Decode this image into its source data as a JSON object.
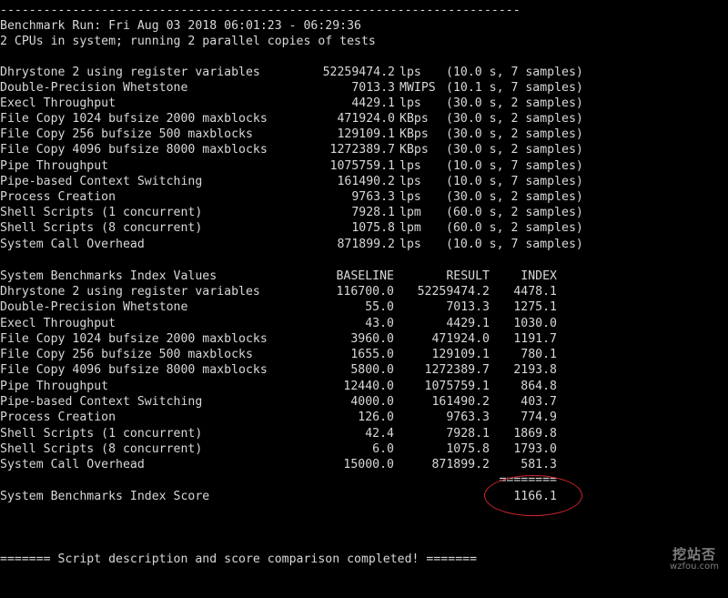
{
  "terminal": {
    "separator_line": "------------------------------------------------------------------------",
    "header_line_1": "Benchmark Run: Fri Aug 03 2018 06:01:23 - 06:29:36",
    "header_line_2": "2 CPUs in system; running 2 parallel copies of tests",
    "raw_results": [
      {
        "test": "Dhrystone 2 using register variables",
        "value": "52259474.2",
        "unit": "lps",
        "detail": "(10.0 s, 7 samples)"
      },
      {
        "test": "Double-Precision Whetstone",
        "value": "7013.3",
        "unit": "MWIPS",
        "detail": "(10.1 s, 7 samples)"
      },
      {
        "test": "Execl Throughput",
        "value": "4429.1",
        "unit": "lps",
        "detail": "(30.0 s, 2 samples)"
      },
      {
        "test": "File Copy 1024 bufsize 2000 maxblocks",
        "value": "471924.0",
        "unit": "KBps",
        "detail": "(30.0 s, 2 samples)"
      },
      {
        "test": "File Copy 256 bufsize 500 maxblocks",
        "value": "129109.1",
        "unit": "KBps",
        "detail": "(30.0 s, 2 samples)"
      },
      {
        "test": "File Copy 4096 bufsize 8000 maxblocks",
        "value": "1272389.7",
        "unit": "KBps",
        "detail": "(30.0 s, 2 samples)"
      },
      {
        "test": "Pipe Throughput",
        "value": "1075759.1",
        "unit": "lps",
        "detail": "(10.0 s, 7 samples)"
      },
      {
        "test": "Pipe-based Context Switching",
        "value": "161490.2",
        "unit": "lps",
        "detail": "(10.0 s, 7 samples)"
      },
      {
        "test": "Process Creation",
        "value": "9763.3",
        "unit": "lps",
        "detail": "(30.0 s, 2 samples)"
      },
      {
        "test": "Shell Scripts (1 concurrent)",
        "value": "7928.1",
        "unit": "lpm",
        "detail": "(60.0 s, 2 samples)"
      },
      {
        "test": "Shell Scripts (8 concurrent)",
        "value": "1075.8",
        "unit": "lpm",
        "detail": "(60.0 s, 2 samples)"
      },
      {
        "test": "System Call Overhead",
        "value": "871899.2",
        "unit": "lps",
        "detail": "(10.0 s, 7 samples)"
      }
    ],
    "index_header": {
      "title": "System Benchmarks Index Values",
      "baseline": "BASELINE",
      "result": "RESULT",
      "index": "INDEX"
    },
    "index_rows": [
      {
        "test": "Dhrystone 2 using register variables",
        "baseline": "116700.0",
        "result": "52259474.2",
        "index": "4478.1"
      },
      {
        "test": "Double-Precision Whetstone",
        "baseline": "55.0",
        "result": "7013.3",
        "index": "1275.1"
      },
      {
        "test": "Execl Throughput",
        "baseline": "43.0",
        "result": "4429.1",
        "index": "1030.0"
      },
      {
        "test": "File Copy 1024 bufsize 2000 maxblocks",
        "baseline": "3960.0",
        "result": "471924.0",
        "index": "1191.7"
      },
      {
        "test": "File Copy 256 bufsize 500 maxblocks",
        "baseline": "1655.0",
        "result": "129109.1",
        "index": "780.1"
      },
      {
        "test": "File Copy 4096 bufsize 8000 maxblocks",
        "baseline": "5800.0",
        "result": "1272389.7",
        "index": "2193.8"
      },
      {
        "test": "Pipe Throughput",
        "baseline": "12440.0",
        "result": "1075759.1",
        "index": "864.8"
      },
      {
        "test": "Pipe-based Context Switching",
        "baseline": "4000.0",
        "result": "161490.2",
        "index": "403.7"
      },
      {
        "test": "Process Creation",
        "baseline": "126.0",
        "result": "9763.3",
        "index": "774.9"
      },
      {
        "test": "Shell Scripts (1 concurrent)",
        "baseline": "42.4",
        "result": "7928.1",
        "index": "1869.8"
      },
      {
        "test": "Shell Scripts (8 concurrent)",
        "baseline": "6.0",
        "result": "1075.8",
        "index": "1793.0"
      },
      {
        "test": "System Call Overhead",
        "baseline": "15000.0",
        "result": "871899.2",
        "index": "581.3"
      }
    ],
    "score_separator": "========",
    "score_label": "System Benchmarks Index Score",
    "score_value": "1166.1",
    "footer_line": "======= Script description and score comparison completed! ======="
  },
  "watermark": {
    "main": "挖站否",
    "sub": "wzfou.com"
  },
  "colors": {
    "background": "#000000",
    "text": "#d8d8d8",
    "highlight_circle": "#d3262b",
    "watermark": "#7e7e7e"
  }
}
